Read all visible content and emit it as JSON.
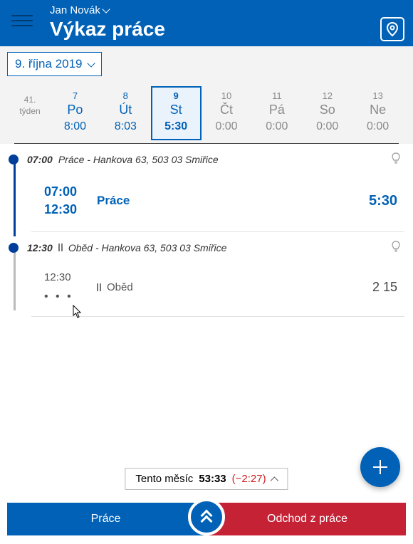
{
  "header": {
    "user": "Jan Novák",
    "title": "Výkaz práce"
  },
  "date_selector": {
    "label": "9. října 2019"
  },
  "week": {
    "label_line1": "41.",
    "label_line2": "týden",
    "days": [
      {
        "num": "7",
        "name": "Po",
        "hrs": "8:00",
        "zero": false,
        "selected": false
      },
      {
        "num": "8",
        "name": "Út",
        "hrs": "8:03",
        "zero": false,
        "selected": false
      },
      {
        "num": "9",
        "name": "St",
        "hrs": "5:30",
        "zero": false,
        "selected": true
      },
      {
        "num": "10",
        "name": "Čt",
        "hrs": "0:00",
        "zero": true,
        "selected": false
      },
      {
        "num": "11",
        "name": "Pá",
        "hrs": "0:00",
        "zero": true,
        "selected": false
      },
      {
        "num": "12",
        "name": "So",
        "hrs": "0:00",
        "zero": true,
        "selected": false
      },
      {
        "num": "13",
        "name": "Ne",
        "hrs": "0:00",
        "zero": true,
        "selected": false
      }
    ]
  },
  "timeline": {
    "entries": [
      {
        "start_time": "07:00",
        "head_label": "Práce - Hankova 63, 503 03 Smiřice",
        "card": {
          "t1": "07:00",
          "t2": "12:30",
          "main": "Práce",
          "right": "5:30"
        },
        "line_color": "blue"
      },
      {
        "start_time": "12:30",
        "head_label": "Oběd - Hankova 63, 503 03 Smiřice",
        "card2": {
          "t1": "12:30",
          "ellipsis": "• • •",
          "main": "Oběd",
          "right": "2 15"
        },
        "line_color": "grey",
        "pause": true
      }
    ]
  },
  "summary": {
    "label": "Tento měsíc",
    "total": "53:33",
    "delta": "(−2:27)"
  },
  "bottom": {
    "left": "Práce",
    "right": "Odchod z práce"
  }
}
